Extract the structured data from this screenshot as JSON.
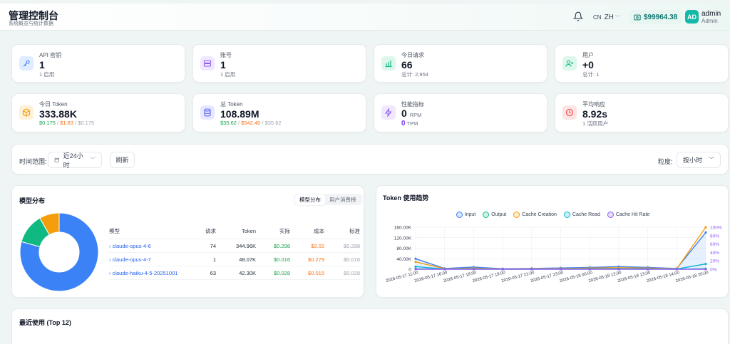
{
  "header": {
    "title": "管理控制台",
    "subtitle": "系统概览与统计数据",
    "lang_flag": "CN",
    "lang": "ZH",
    "balance": "$99964.38",
    "avatar": "AD",
    "username": "admin",
    "role": "Admin"
  },
  "stats": [
    {
      "label": "API 密钥",
      "value": "1",
      "sub": "1 启用",
      "icon": "key-icon",
      "color": "#3b82f6",
      "bg": "#e0ecff"
    },
    {
      "label": "账号",
      "value": "1",
      "sub": "1 启用",
      "icon": "server-icon",
      "color": "#8b5cf6",
      "bg": "#f0e8ff"
    },
    {
      "label": "今日请求",
      "value": "66",
      "sub": "总计: 2,954",
      "icon": "bar-chart-icon",
      "color": "#10b981",
      "bg": "#ddf7ec"
    },
    {
      "label": "用户",
      "value": "+0",
      "sub": "总计: 1",
      "icon": "user-plus-icon",
      "color": "#10b981",
      "bg": "#ddf7ec"
    },
    {
      "label": "今日 Token",
      "value": "333.88K",
      "sub_parts": [
        "$0.175",
        " / ",
        "$1.83",
        " / $0.175"
      ],
      "icon": "cube-icon",
      "color": "#f59e0b",
      "bg": "#fdf1d6"
    },
    {
      "label": "总 Token",
      "value": "108.89M",
      "sub_parts": [
        "$35.62",
        " / ",
        "$542.40",
        " / $35.62"
      ],
      "icon": "database-icon",
      "color": "#6366f1",
      "bg": "#e6e8ff"
    },
    {
      "label": "性能指标",
      "value": "0",
      "value_unit": "RPM",
      "value2": "0",
      "value2_unit": "TPM",
      "icon": "bolt-icon",
      "color": "#8b5cf6",
      "bg": "#f0e8ff"
    },
    {
      "label": "平均响应",
      "value": "8.92s",
      "sub": "1 活跃用户",
      "icon": "clock-icon",
      "color": "#ef4444",
      "bg": "#fde4e4"
    }
  ],
  "filter": {
    "label": "时间范围:",
    "range": "近24小时",
    "refresh": "刷新",
    "granularity_label": "粒度:",
    "granularity": "按小时"
  },
  "model_panel": {
    "title": "模型分布",
    "tabs": [
      "模型分布",
      "用户消费榜"
    ],
    "active_tab": 0,
    "headers": [
      "模型",
      "请求",
      "Token",
      "实际",
      "成本",
      "标准"
    ],
    "rows": [
      [
        "claude-opus-4-6",
        "74",
        "344.96K",
        "$0.298",
        "$2.02",
        "$0.298"
      ],
      [
        "claude-opus-4-7",
        "1",
        "48.07K",
        "$0.016",
        "$0.279",
        "$0.016"
      ],
      [
        "claude-haiku-4-5-20251001",
        "63",
        "42.30K",
        "$0.028",
        "$0.015",
        "$0.028"
      ]
    ],
    "donut": [
      {
        "share": 0.793,
        "color": "#3b82f6"
      },
      {
        "share": 0.125,
        "color": "#10b981"
      },
      {
        "share": 0.082,
        "color": "#f59e0b"
      }
    ]
  },
  "trend_panel": {
    "title": "Token 使用趋势"
  },
  "recent": {
    "title": "最近使用 (Top 12)"
  },
  "chart_data": {
    "type": "line",
    "x": [
      "2026-05-17 11:00",
      "2026-05-17 16:00",
      "2026-05-17 18:00",
      "2026-05-17 19:00",
      "2026-05-17 21:00",
      "2026-05-17 23:00",
      "2026-05-18 00:00",
      "2026-05-18 12:00",
      "2026-05-18 13:00",
      "2026-05-18 14:00",
      "2026-05-18 20:00"
    ],
    "series": [
      {
        "name": "Input",
        "color": "#3b82f6",
        "axis": "left",
        "values": [
          40000,
          3000,
          8000,
          2000,
          3000,
          5000,
          7000,
          10000,
          7000,
          3000,
          140000
        ]
      },
      {
        "name": "Output",
        "color": "#10b981",
        "axis": "left",
        "values": [
          1000,
          500,
          800,
          300,
          400,
          600,
          700,
          900,
          700,
          400,
          2000
        ]
      },
      {
        "name": "Cache Creation",
        "color": "#f59e0b",
        "axis": "left",
        "values": [
          28000,
          2000,
          4000,
          1000,
          2000,
          3000,
          4000,
          6000,
          4000,
          2000,
          160000
        ]
      },
      {
        "name": "Cache Read",
        "color": "#06b6d4",
        "axis": "left",
        "values": [
          10000,
          800,
          1500,
          500,
          900,
          1200,
          1500,
          2000,
          1500,
          800,
          20000
        ]
      },
      {
        "name": "Cache Hit Rate",
        "color": "#8b5cf6",
        "axis": "right",
        "values": [
          0,
          0,
          0,
          0,
          0,
          0,
          0,
          0,
          0,
          0,
          0
        ]
      }
    ],
    "yticks_left": [
      "0",
      "40.00K",
      "80.00K",
      "120.00K",
      "160.00K"
    ],
    "yticks_right": [
      "0%",
      "20%",
      "40%",
      "60%",
      "80%",
      "100%"
    ],
    "ylim_left": [
      0,
      160000
    ],
    "ylim_right": [
      0,
      100
    ],
    "legend": "top",
    "grid": true
  }
}
